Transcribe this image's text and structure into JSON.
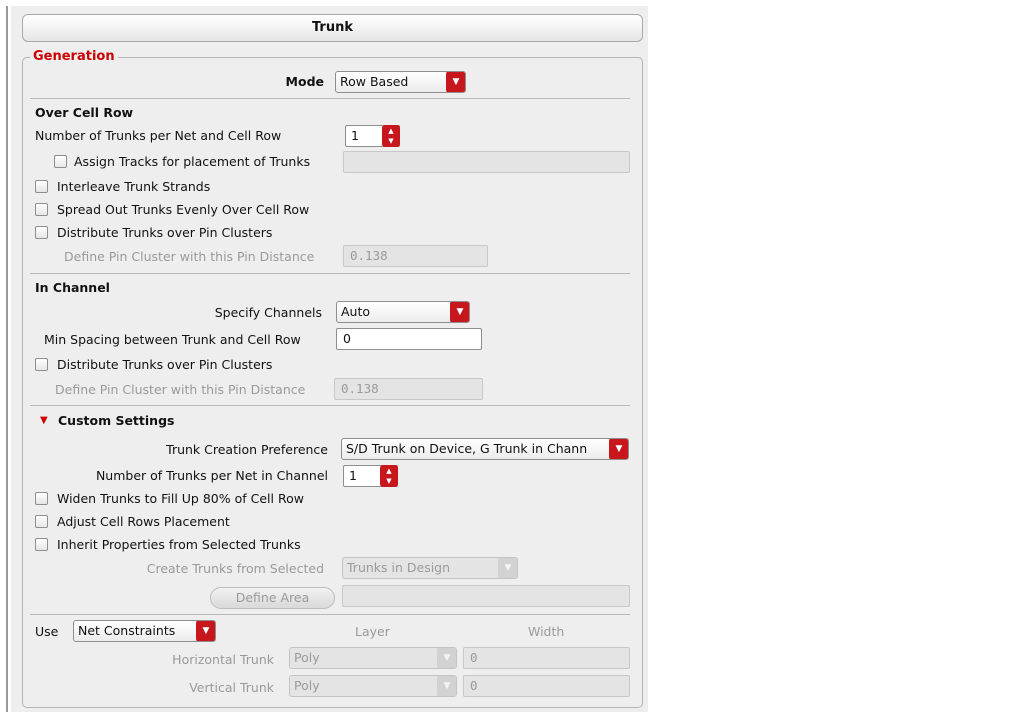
{
  "panel": {
    "title": "Trunk"
  },
  "generation": {
    "title": "Generation",
    "mode_label": "Mode",
    "mode_value": "Row Based"
  },
  "over_cell_row": {
    "title": "Over Cell Row",
    "trunks_per_net_label": "Number of Trunks per Net and Cell Row",
    "trunks_per_net_value": "1",
    "assign_tracks_label": "Assign Tracks for placement of Trunks",
    "assign_tracks_value": "",
    "interleave_label": "Interleave Trunk Strands",
    "spread_out_label": "Spread Out Trunks Evenly Over Cell Row",
    "distribute_label": "Distribute Trunks over Pin Clusters",
    "pin_cluster_label": "Define Pin Cluster with this Pin Distance",
    "pin_cluster_value": "0.138"
  },
  "in_channel": {
    "title": "In Channel",
    "specify_channels_label": "Specify Channels",
    "specify_channels_value": "Auto",
    "min_spacing_label": "Min Spacing between Trunk and Cell Row",
    "min_spacing_value": "0",
    "distribute_label": "Distribute Trunks over Pin Clusters",
    "pin_cluster_label": "Define Pin Cluster with this Pin Distance",
    "pin_cluster_value": "0.138"
  },
  "custom_settings": {
    "title": "Custom Settings",
    "creation_pref_label": "Trunk Creation Preference",
    "creation_pref_value": "S/D Trunk on Device, G Trunk in Chann",
    "trunks_in_channel_label": "Number of Trunks per Net in Channel",
    "trunks_in_channel_value": "1",
    "widen_label": "Widen Trunks to Fill Up 80% of Cell Row",
    "adjust_label": "Adjust Cell Rows Placement",
    "inherit_label": "Inherit Properties from Selected Trunks",
    "create_from_label": "Create Trunks from Selected",
    "create_from_value": "Trunks in Design",
    "define_area_label": "Define Area",
    "define_area_value": ""
  },
  "use_section": {
    "use_label": "Use",
    "use_value": "Net Constraints",
    "layer_header": "Layer",
    "width_header": "Width",
    "horizontal_label": "Horizontal Trunk",
    "horizontal_layer": "Poly",
    "horizontal_width": "0",
    "vertical_label": "Vertical Trunk",
    "vertical_layer": "Poly",
    "vertical_width": "0"
  },
  "colors": {
    "accent": "#cc0000",
    "dropdown_button": "#c8161d",
    "panel_bg": "#eeeeee"
  },
  "icons": {
    "dropdown": "chevron-down-icon",
    "spinner": "spinner-arrows-icon",
    "section_toggle": "triangle-down-icon"
  }
}
